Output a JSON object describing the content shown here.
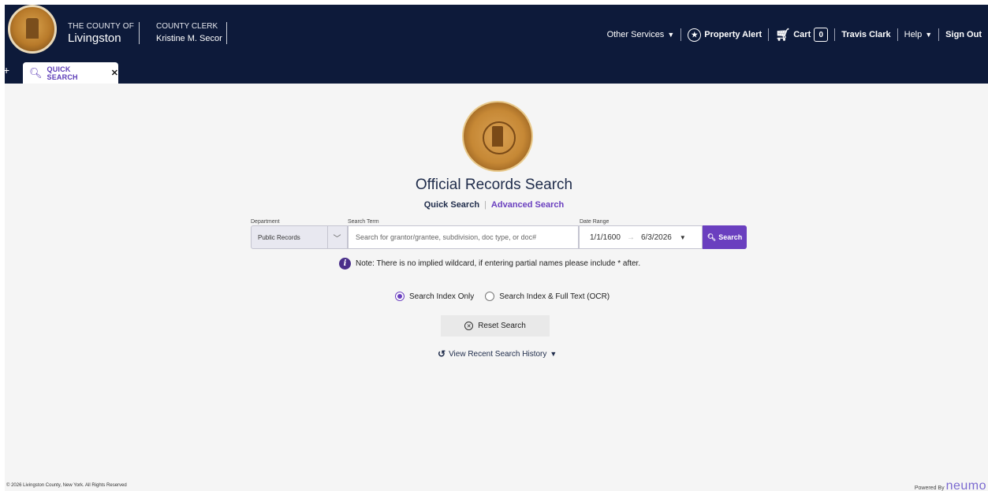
{
  "header": {
    "county_of": "THE COUNTY OF",
    "county_name": "Livingston",
    "clerk_title": "COUNTY CLERK",
    "clerk_name": "Kristine M. Secor"
  },
  "nav": {
    "other_services": "Other Services",
    "property_alert": "Property Alert",
    "cart": "Cart",
    "cart_count": "0",
    "user": "Travis Clark",
    "help": "Help",
    "sign_out": "Sign Out"
  },
  "tabs": {
    "add": "+",
    "active_label": "QUICK SEARCH",
    "close": "✕"
  },
  "page": {
    "title": "Official Records Search",
    "mode_quick": "Quick Search",
    "mode_advanced": "Advanced Search"
  },
  "form": {
    "department_label": "Department",
    "department_value": "Public Records",
    "search_term_label": "Search Term",
    "search_placeholder": "Search for grantor/grantee, subdivision, doc type, or doc#",
    "date_range_label": "Date Range",
    "date_from": "1/1/1600",
    "date_to": "6/3/2026",
    "search_button": "Search"
  },
  "note": "Note: There is no implied wildcard, if entering partial names please include * after.",
  "radios": {
    "index_only": "Search Index Only",
    "index_full_text": "Search Index & Full Text (OCR)",
    "selected": "index_only"
  },
  "reset_button": "Reset Search",
  "history_link": "View Recent Search History",
  "footer": {
    "copyright": "© 2026 Livingston County, New York. All Rights Reserved",
    "powered_by": "Powered By",
    "brand": "neumo"
  },
  "colors": {
    "header_bg": "#0d1a3a",
    "accent": "#6a3fbf",
    "page_bg": "#f5f5f5"
  }
}
